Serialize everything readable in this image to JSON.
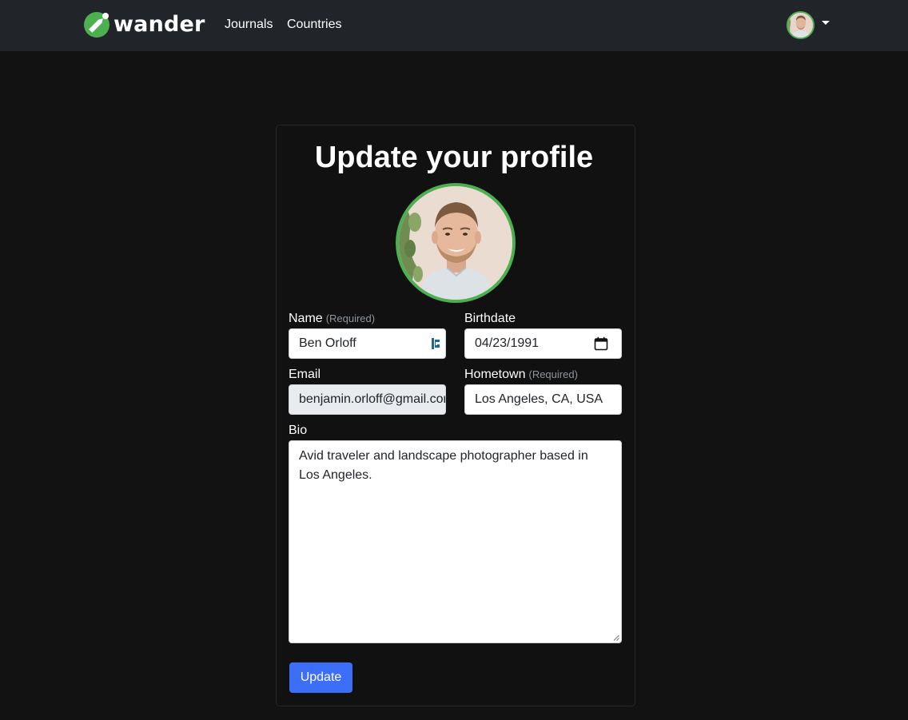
{
  "nav": {
    "brand": "wander",
    "links": [
      "Journals",
      "Countries"
    ]
  },
  "form": {
    "title": "Update your profile",
    "fields": {
      "name": {
        "label": "Name",
        "hint": "(Required)",
        "value": "Ben Orloff"
      },
      "birthdate": {
        "label": "Birthdate",
        "value": "04/23/1991"
      },
      "email": {
        "label": "Email",
        "value": "benjamin.orloff@gmail.com"
      },
      "hometown": {
        "label": "Hometown",
        "hint": "(Required)",
        "value": "Los Angeles, CA, USA"
      },
      "bio": {
        "label": "Bio",
        "value": "Avid traveler and landscape photographer based in Los Angeles."
      }
    },
    "submit_label": "Update"
  },
  "icons": {
    "brand": "pencil-icon",
    "password_manager": "password-manager-icon",
    "calendar": "calendar-icon",
    "user_menu_caret": "caret-down-icon"
  },
  "colors": {
    "background": "#121212",
    "navbar": "#212529",
    "accent_green": "#4caf50",
    "primary_button": "#3d6ef7"
  }
}
